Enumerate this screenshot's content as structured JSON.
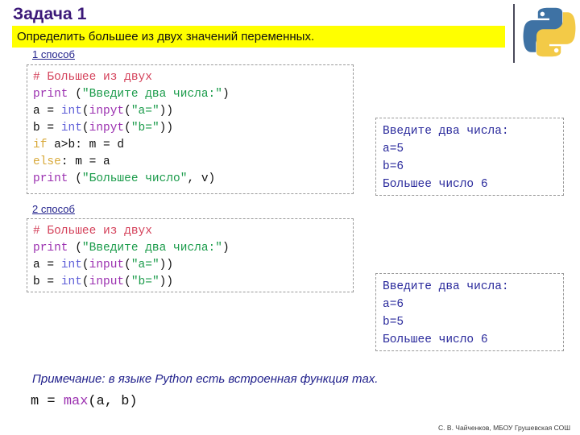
{
  "slide": {
    "title": "Задача 1",
    "banner_text": "Определить большее из двух значений переменных.",
    "footer": "С. В. Чайченков, МБОУ Грушевская СОШ"
  },
  "logo": {
    "name": "python-logo",
    "blue": "#3e72a4",
    "yellow": "#f3ca47"
  },
  "colors": {
    "title": "#3b1878",
    "banner_bg": "#ffff00",
    "label": "#22228c",
    "comment": "#d4415a",
    "function": "#9b30b0",
    "string": "#1a9b4a",
    "builtin": "#5f5fd8",
    "keyword": "#d8a93a",
    "output_text": "#2a2a9c"
  },
  "method1": {
    "label": "1 способ",
    "code_lines": [
      {
        "parts": [
          {
            "t": "# Большее из двух",
            "c": "cmt"
          }
        ]
      },
      {
        "parts": [
          {
            "t": "print",
            "c": "fn"
          },
          {
            "t": " (",
            "c": ""
          },
          {
            "t": "\"Введите два числа:\"",
            "c": "str"
          },
          {
            "t": ")",
            "c": ""
          }
        ]
      },
      {
        "parts": [
          {
            "t": "a = ",
            "c": ""
          },
          {
            "t": "int",
            "c": "bi"
          },
          {
            "t": "(",
            "c": ""
          },
          {
            "t": "inpyt",
            "c": "fn"
          },
          {
            "t": "(",
            "c": ""
          },
          {
            "t": "\"a=\"",
            "c": "str"
          },
          {
            "t": "))",
            "c": ""
          }
        ]
      },
      {
        "parts": [
          {
            "t": "b = ",
            "c": ""
          },
          {
            "t": "int",
            "c": "bi"
          },
          {
            "t": "(",
            "c": ""
          },
          {
            "t": "inpyt",
            "c": "fn"
          },
          {
            "t": "(",
            "c": ""
          },
          {
            "t": "\"b=\"",
            "c": "str"
          },
          {
            "t": "))",
            "c": ""
          }
        ]
      },
      {
        "parts": [
          {
            "t": "if",
            "c": "kw"
          },
          {
            "t": " a>b: m = d",
            "c": ""
          }
        ]
      },
      {
        "parts": [
          {
            "t": "else",
            "c": "kw"
          },
          {
            "t": ": m = a",
            "c": ""
          }
        ]
      },
      {
        "parts": [
          {
            "t": "print",
            "c": "fn"
          },
          {
            "t": " (",
            "c": ""
          },
          {
            "t": "\"Большее число\"",
            "c": "str"
          },
          {
            "t": ", v)",
            "c": ""
          }
        ]
      }
    ],
    "output_lines": [
      "Введите два числа:",
      "a=5",
      "b=6",
      "Большее число 6"
    ]
  },
  "method2": {
    "label": "2 способ",
    "code_lines": [
      {
        "parts": [
          {
            "t": "# Большее из двух",
            "c": "cmt"
          }
        ]
      },
      {
        "parts": [
          {
            "t": "print",
            "c": "fn"
          },
          {
            "t": " (",
            "c": ""
          },
          {
            "t": "\"Введите два числа:\"",
            "c": "str"
          },
          {
            "t": ")",
            "c": ""
          }
        ]
      },
      {
        "parts": [
          {
            "t": "a = ",
            "c": ""
          },
          {
            "t": "int",
            "c": "bi"
          },
          {
            "t": "(",
            "c": ""
          },
          {
            "t": "input",
            "c": "fn"
          },
          {
            "t": "(",
            "c": ""
          },
          {
            "t": "\"a=\"",
            "c": "str"
          },
          {
            "t": "))",
            "c": ""
          }
        ]
      },
      {
        "parts": [
          {
            "t": "b = ",
            "c": ""
          },
          {
            "t": "int",
            "c": "bi"
          },
          {
            "t": "(",
            "c": ""
          },
          {
            "t": "input",
            "c": "fn"
          },
          {
            "t": "(",
            "c": ""
          },
          {
            "t": "\"b=\"",
            "c": "str"
          },
          {
            "t": "))",
            "c": ""
          }
        ]
      }
    ],
    "output_lines": [
      "Введите два числа:",
      "a=6",
      "b=5",
      "Большее число 6"
    ]
  },
  "note": {
    "text": "Примечание: в языке Python есть встроенная функция max.",
    "formula_parts": [
      {
        "t": "m = ",
        "c": ""
      },
      {
        "t": "max",
        "c": "fn"
      },
      {
        "t": "(a, b)",
        "c": ""
      }
    ]
  }
}
